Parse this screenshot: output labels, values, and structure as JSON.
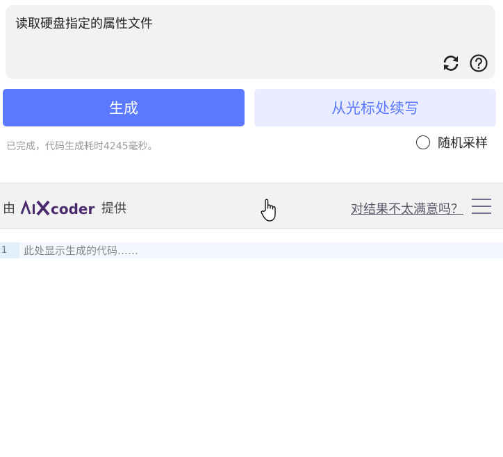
{
  "prompt": {
    "text": "读取硬盘指定的属性文件"
  },
  "icons": {
    "refresh": "refresh-icon",
    "help": "help-icon",
    "menu": "menu-icon",
    "cursor": "hand-cursor-icon"
  },
  "actions": {
    "generate_label": "生成",
    "continue_label": "从光标处续写"
  },
  "status": {
    "text": "已完成，代码生成耗时4245毫秒。"
  },
  "options": {
    "random_sample_label": "随机采样",
    "random_sample_checked": false
  },
  "provider": {
    "prefix": "由",
    "brand": "aiXcoder",
    "suffix": "提供",
    "feedback_link": "对结果不太满意吗？"
  },
  "editor": {
    "lines": [
      {
        "number": "1",
        "placeholder": "此处显示生成的代码……"
      }
    ]
  },
  "colors": {
    "primary": "#5b79ff",
    "primary_light": "#e9edff",
    "panel_bg": "#f2f2f2",
    "brand_purple": "#4b2a6e"
  }
}
